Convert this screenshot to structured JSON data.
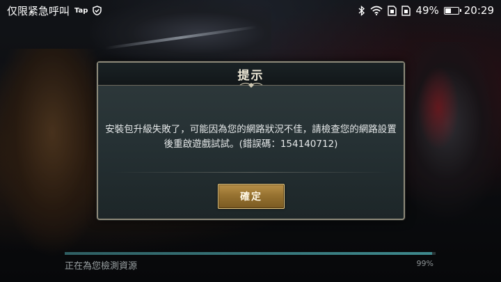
{
  "status_bar": {
    "notification_text": "仅限紧急呼叫",
    "tap_label": "Tap",
    "battery_percent_text": "49%",
    "battery_level": 0.49,
    "time": "20:29",
    "icons": [
      "shield-check-icon",
      "bluetooth-icon",
      "wifi-icon",
      "sim-card-icon",
      "sim-card-icon",
      "battery-icon"
    ]
  },
  "dialog": {
    "title": "提示",
    "message": "安裝包升級失敗了，可能因為您的網路狀況不佳，請檢查您的網路設置後重啟遊戲試試。(錯誤碼：154140712)",
    "confirm_label": "確定",
    "accent_color": "#b78f48"
  },
  "loading": {
    "status_text": "正在為您檢測資源",
    "percent_text": "99%",
    "progress": 0.99
  }
}
